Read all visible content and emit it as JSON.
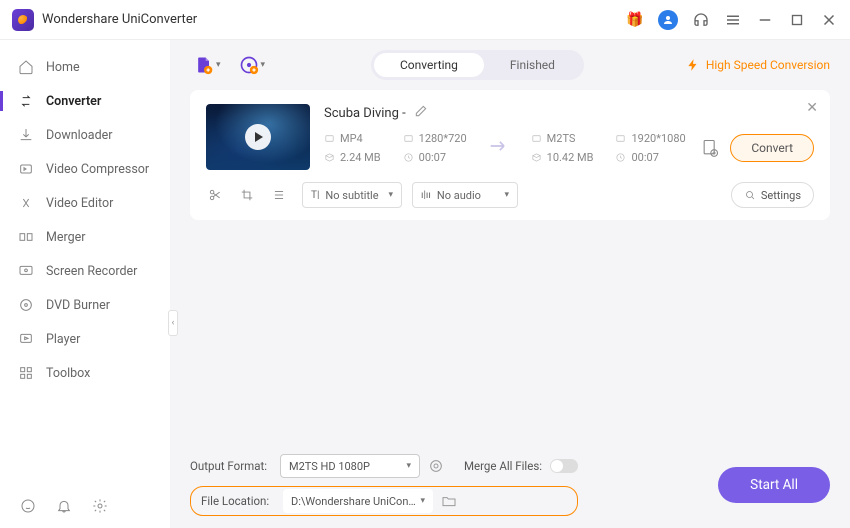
{
  "app": {
    "title": "Wondershare UniConverter"
  },
  "titlebar": {
    "gift": "gift-icon",
    "help": "headset-icon",
    "menu": "menu-icon"
  },
  "sidebar": {
    "items": [
      {
        "label": "Home",
        "icon": "home-icon"
      },
      {
        "label": "Converter",
        "icon": "converter-icon"
      },
      {
        "label": "Downloader",
        "icon": "downloader-icon"
      },
      {
        "label": "Video Compressor",
        "icon": "compressor-icon"
      },
      {
        "label": "Video Editor",
        "icon": "editor-icon"
      },
      {
        "label": "Merger",
        "icon": "merger-icon"
      },
      {
        "label": "Screen Recorder",
        "icon": "recorder-icon"
      },
      {
        "label": "DVD Burner",
        "icon": "dvd-icon"
      },
      {
        "label": "Player",
        "icon": "player-icon"
      },
      {
        "label": "Toolbox",
        "icon": "toolbox-icon"
      }
    ]
  },
  "tabs": {
    "converting": "Converting",
    "finished": "Finished"
  },
  "hs_link": "High Speed Conversion",
  "item": {
    "title": "Scuba Diving -",
    "src": {
      "format": "MP4",
      "res": "1280*720",
      "size": "2.24 MB",
      "dur": "00:07"
    },
    "dst": {
      "format": "M2TS",
      "res": "1920*1080",
      "size": "10.42 MB",
      "dur": "00:07"
    },
    "convert": "Convert",
    "subtitle": "No subtitle",
    "audio": "No audio",
    "settings": "Settings"
  },
  "footer": {
    "output_format_label": "Output Format:",
    "output_format": "M2TS HD 1080P",
    "file_location_label": "File Location:",
    "file_location": "D:\\Wondershare UniConverter",
    "merge_label": "Merge All Files:",
    "start_all": "Start All"
  }
}
